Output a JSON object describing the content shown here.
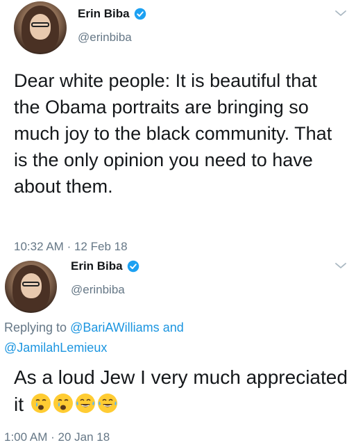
{
  "tweets": [
    {
      "author_name": "Erin Biba",
      "handle": "@erinbiba",
      "text": "Dear white people: It is beautiful that the Obama portraits are bringing so much joy to the black community. That is the only opinion you need to have about them.",
      "time": "10:32 AM",
      "separator": "·",
      "date": "12 Feb 18"
    },
    {
      "author_name": "Erin Biba",
      "handle": "@erinbiba",
      "reply_prefix": "Replying to ",
      "reply_user1": "@BariAWilliams",
      "reply_and": " and",
      "reply_user2": "@JamilahLemieux",
      "text": "As a loud Jew I very much appreciated it",
      "emojis": [
        "crying-face",
        "crying-face",
        "grinning-tears-face",
        "grinning-tears-face"
      ],
      "time": "1:00 AM",
      "separator": "·",
      "date": "20 Jan 18"
    }
  ],
  "colors": {
    "verified": "#1da1f2",
    "link": "#1b95e0",
    "muted": "#657786",
    "text": "#14171a",
    "emoji": "#ffcc33"
  }
}
